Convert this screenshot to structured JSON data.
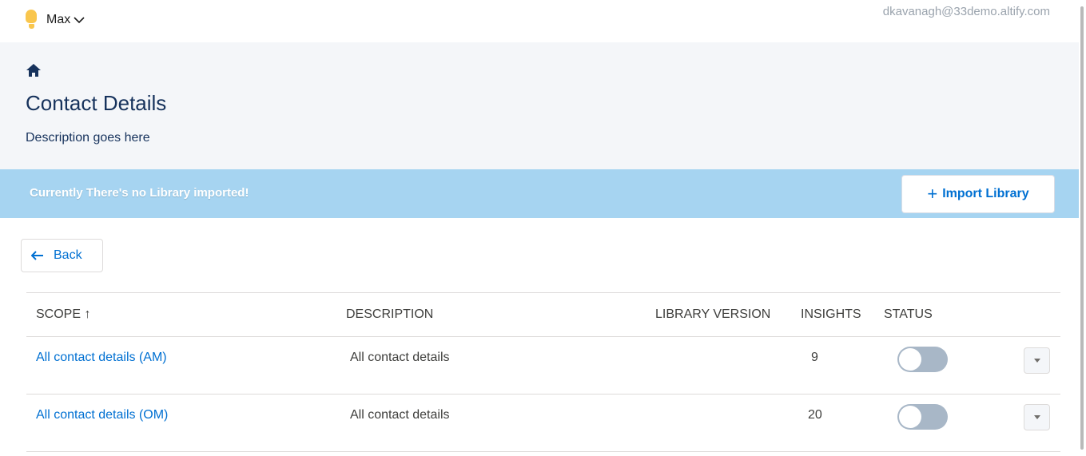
{
  "topbar": {
    "user_name": "Max",
    "email": "dkavanagh@33demo.altify.com"
  },
  "header": {
    "title": "Contact Details",
    "description": "Description goes here"
  },
  "banner": {
    "message": "Currently There's no Library imported!",
    "import_label": "Import Library",
    "import_icon": "+"
  },
  "back_label": "Back",
  "table": {
    "columns": [
      "SCOPE ↑",
      "DESCRIPTION",
      "LIBRARY VERSION",
      "INSIGHTS",
      "STATUS"
    ],
    "rows": [
      {
        "scope": "All contact details (AM)",
        "description": "All contact details",
        "library_version": "",
        "insights": "9",
        "status_on": false
      },
      {
        "scope": "All contact details (OM)",
        "description": "All contact details",
        "library_version": "",
        "insights": "20",
        "status_on": false
      }
    ]
  },
  "colors": {
    "accent": "#0070d2",
    "banner": "#a6d4f1",
    "header_bg": "#f4f6f9",
    "toggle_off": "#a8b7c7",
    "bulb": "#f9c64d"
  },
  "icons": {
    "user": "lightbulb-icon",
    "menu": "chevron-down-icon",
    "home": "home-icon",
    "back": "arrow-left-icon",
    "row_menu": "caret-down-icon"
  }
}
